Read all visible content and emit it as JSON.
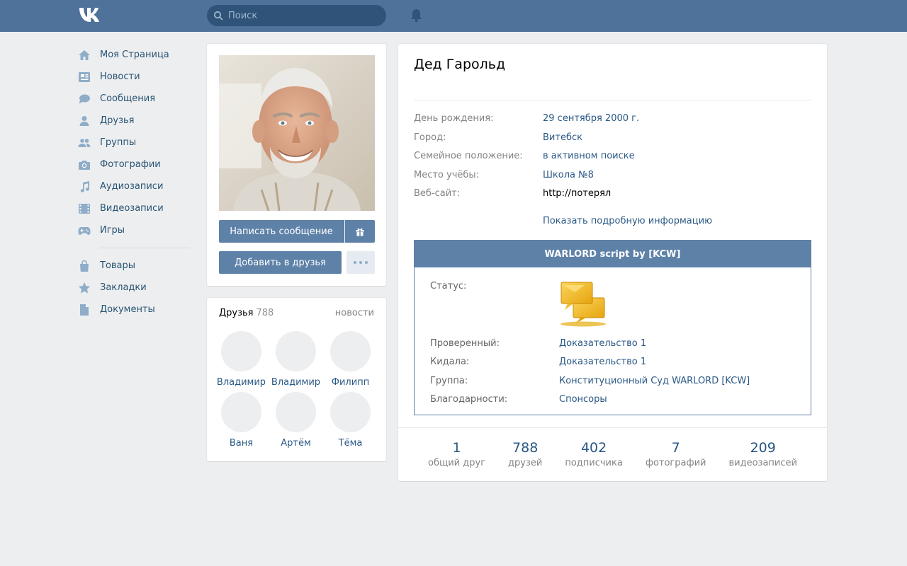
{
  "header": {
    "logo_icon": "vk-logo-icon",
    "search_placeholder": "Поиск",
    "notifications_icon": "bell-icon",
    "colors": {
      "bar": "#4f729a",
      "search_bg": "#2f5379"
    }
  },
  "nav": {
    "items": [
      {
        "icon": "home-icon",
        "label": "Моя Страница"
      },
      {
        "icon": "news-icon",
        "label": "Новости"
      },
      {
        "icon": "messages-icon",
        "label": "Сообщения"
      },
      {
        "icon": "friends-icon",
        "label": "Друзья"
      },
      {
        "icon": "groups-icon",
        "label": "Группы"
      },
      {
        "icon": "camera-icon",
        "label": "Фотографии"
      },
      {
        "icon": "music-icon",
        "label": "Аудиозаписи"
      },
      {
        "icon": "video-icon",
        "label": "Видеозаписи"
      },
      {
        "icon": "gamepad-icon",
        "label": "Игры"
      }
    ],
    "secondary": [
      {
        "icon": "bag-icon",
        "label": "Товары"
      },
      {
        "icon": "star-icon",
        "label": "Закладки"
      },
      {
        "icon": "document-icon",
        "label": "Документы"
      }
    ]
  },
  "profile": {
    "actions": {
      "write_message": "Написать сообщение",
      "gift_icon": "gift-icon",
      "add_friend": "Добавить в друзья",
      "more_icon": "more-dots-icon"
    }
  },
  "friends": {
    "title": "Друзья",
    "count": "788",
    "news_link": "новости",
    "list": [
      "Владимир",
      "Владимир",
      "Филипп",
      "Ваня",
      "Артём",
      "Тёма"
    ]
  },
  "info": {
    "name": "Дед Гарольд",
    "fields": [
      {
        "key": "День рождения:",
        "value": "29 сентября 2000 г."
      },
      {
        "key": "Город:",
        "value": "Витебск"
      },
      {
        "key": "Семейное положение:",
        "value": "в активном поиске"
      },
      {
        "key": "Место учёбы:",
        "value": "Школа №8"
      },
      {
        "key": "Веб-сайт:",
        "value": "http://потерял"
      }
    ],
    "show_more": "Показать подробную информацию"
  },
  "warlord": {
    "title": "WARLORD script by [KCW]",
    "status_label": "Статус:",
    "status_icon": "chat-bubbles-icon",
    "rows": [
      {
        "key": "Проверенный:",
        "value": "Доказательство 1"
      },
      {
        "key": "Кидала:",
        "value": "Доказательство 1"
      },
      {
        "key": "Группа:",
        "value": "Конституционный Суд WARLORD [KCW]"
      },
      {
        "key": "Благодарности:",
        "value": "Спонсоры"
      }
    ]
  },
  "stats": [
    {
      "number": "1",
      "label": "общий друг"
    },
    {
      "number": "788",
      "label": "друзей"
    },
    {
      "number": "402",
      "label": "подписчика"
    },
    {
      "number": "7",
      "label": "фотографий"
    },
    {
      "number": "209",
      "label": "видеозаписей"
    }
  ]
}
